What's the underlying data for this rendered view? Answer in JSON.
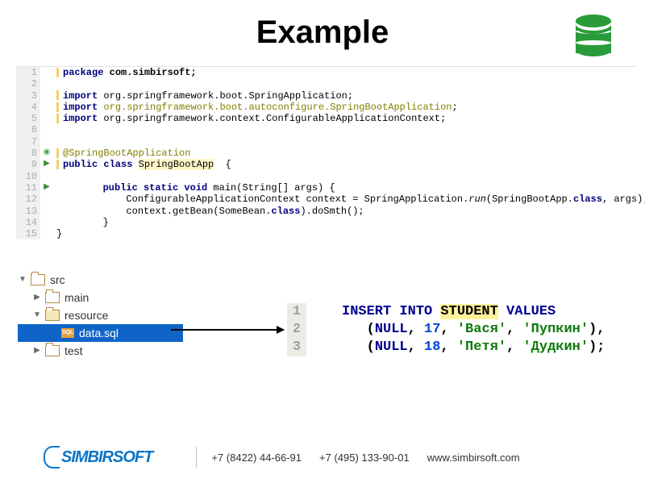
{
  "title": "Example",
  "java": {
    "lines": [
      "1",
      "2",
      "3",
      "4",
      "5",
      "6",
      "7",
      "8",
      "9",
      "10",
      "11",
      "12",
      "13",
      "14",
      "15"
    ],
    "l1_pkg": "package",
    "l1_path": " com.simbirsoft;",
    "l3_imp": "import",
    "l3_path": " org.springframework.boot.SpringApplication;",
    "l4_imp": "import",
    "l4_path": " org.springframework.boot.autoconfigure.SpringBootApplication",
    "l5_imp": "import",
    "l5_path": " org.springframework.context.ConfigurableApplicationContext;",
    "l8_ann": "@SpringBootApplication",
    "l9_pub": "public class ",
    "l9_cls": "SpringBootApp",
    "l9_open": "  {",
    "l11_pre": "        ",
    "l11_mod": "public static void",
    "l11_sig": " main(String[] args) {",
    "l12_pre": "            ConfigurableApplicationContext context = SpringApplication.",
    "l12_run": "run",
    "l12_mid": "(SpringBootApp.",
    "l12_cls": "class",
    "l12_end": ", args);",
    "l13_pre": "            context.getBean(SomeBean.",
    "l13_cls": "class",
    "l13_end": ").doSmth();",
    "l14": "        }",
    "l15": "}",
    "semi": ";"
  },
  "tree": {
    "src": "src",
    "main": "main",
    "resource": "resource",
    "file": "data.sql",
    "test": "test"
  },
  "sql": {
    "lines": [
      "1",
      "2",
      "3"
    ],
    "l1_ins": "INSERT INTO ",
    "l1_tbl": "STUDENT",
    "l1_val": " VALUES",
    "l2_open": "   (",
    "kw_null": "NULL",
    "l2_num": "17",
    "l2_n1": "'Вася'",
    "l2_n2": "'Пупкин'",
    "l2_close": "),",
    "l3_num": "18",
    "l3_n1": "'Петя'",
    "l3_n2": "'Дудкин'",
    "l3_close": ");",
    "comma": ", "
  },
  "footer": {
    "logo": "SIMBIRSOFT",
    "ph1": "+7 (8422) 44-66-91",
    "ph2": "+7 (495) 133-90-01",
    "site": "www.simbirsoft.com"
  }
}
